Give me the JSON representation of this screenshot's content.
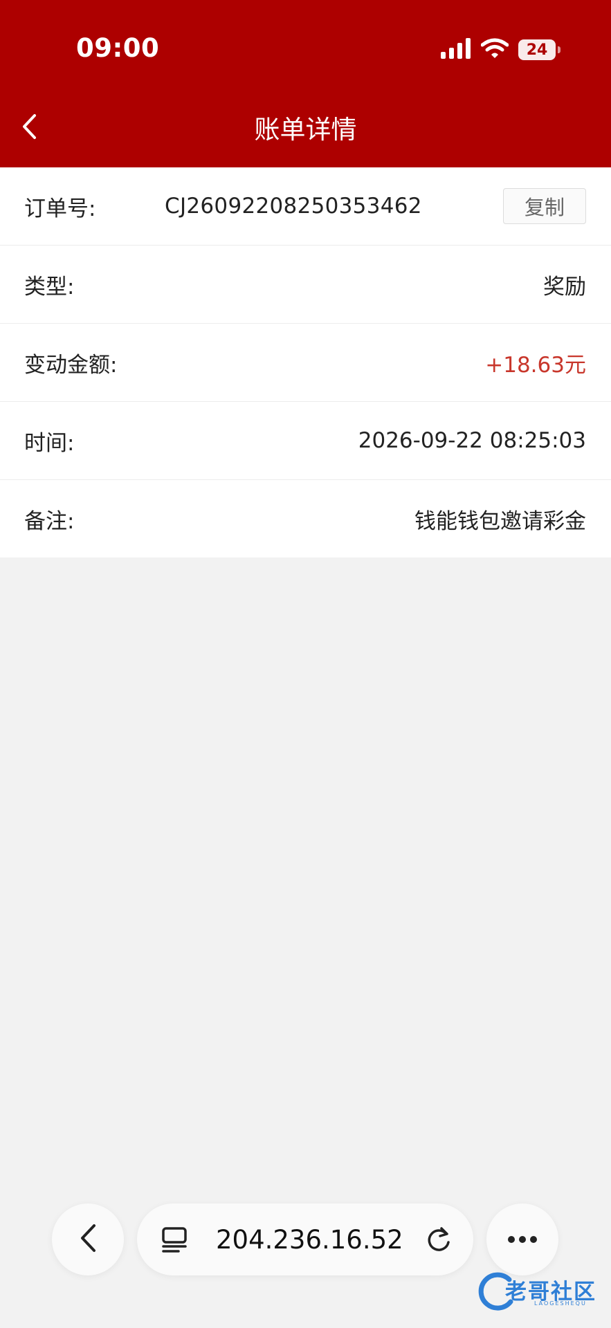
{
  "status_bar": {
    "time": "09:00",
    "battery": "24"
  },
  "header": {
    "title": "账单详情"
  },
  "detail": {
    "order_label": "订单号:",
    "order_no": "CJ26092208250353462",
    "copy_label": "复制",
    "type_label": "类型:",
    "type_value": "奖励",
    "amount_label": "变动金额:",
    "amount_value": "+18.63元",
    "time_label": "时间:",
    "time_value": "2026-09-22 08:25:03",
    "note_label": "备注:",
    "note_value": "钱能钱包邀请彩金"
  },
  "browser_bar": {
    "url": "204.236.16.52"
  },
  "watermark": {
    "text": "老哥社区",
    "subtext": "LAOGESHEQU"
  },
  "colors": {
    "header": "#ad0000",
    "amount": "#c8362b",
    "background": "#f2f2f2"
  }
}
